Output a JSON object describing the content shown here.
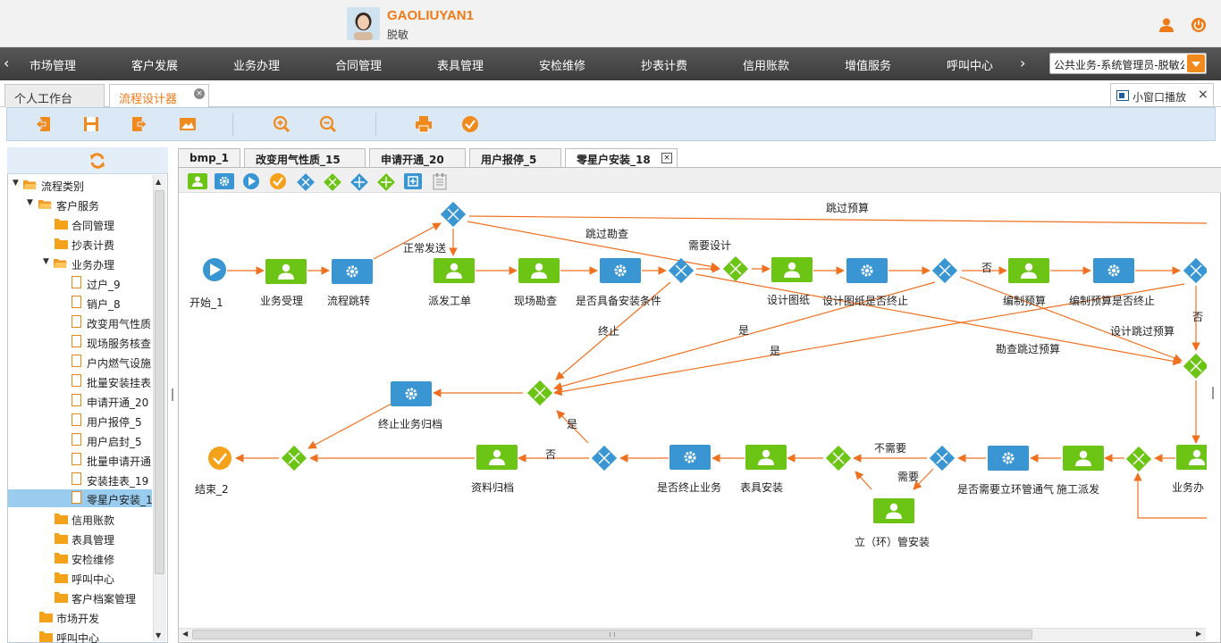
{
  "user": {
    "name": "GAOLIUYAN1",
    "role": "脱敏"
  },
  "nav": {
    "items": [
      "市场管理",
      "客户发展",
      "业务办理",
      "合同管理",
      "表具管理",
      "安检维修",
      "抄表计费",
      "信用账款",
      "增值服务",
      "呼叫中心"
    ]
  },
  "role_selector": {
    "value": "公共业务-系统管理员-脱敏公"
  },
  "tabs": [
    "个人工作台",
    "流程设计器"
  ],
  "mini_window": "小窗口播放",
  "tree": {
    "root": "流程类别",
    "customer_service": "客户服务",
    "contract": "合同管理",
    "metering": "抄表计费",
    "business": "业务办理",
    "leaves": [
      "过户_9",
      "销户_8",
      "改变用气性质",
      "现场服务核查",
      "户内燃气设施",
      "批量安装挂表",
      "申请开通_20",
      "用户报停_5",
      "用户启封_5",
      "批量申请开通",
      "安装挂表_19",
      "零星户安装_1"
    ],
    "after": [
      "信用账款",
      "表具管理",
      "安检维修",
      "呼叫中心",
      "客户档案管理"
    ],
    "market": "市场开发",
    "callcenter": "呼叫中心"
  },
  "process_tabs": [
    "bmp_1",
    "改变用气性质_15",
    "申请开通_20",
    "用户报停_5",
    "零星户安装_18"
  ],
  "diagram": {
    "nodes": {
      "start": "开始_1",
      "accept": "业务受理",
      "jump": "流程跳转",
      "dispatch": "派发工单",
      "survey": "现场勘查",
      "cond": "是否具备安装条件",
      "design": "设计图纸",
      "design_end": "设计图纸是否终止",
      "budget": "编制预算",
      "budget_end": "编制预算是否终止",
      "archive_end": "终止业务归档",
      "end": "结束_2",
      "docs": "资料归档",
      "is_end": "是否终止业务",
      "meter": "表具安装",
      "need_pipe": "是否需要立环管通气",
      "construct": "施工派发",
      "biz": "业务办",
      "pipe": "立（环）管安装"
    },
    "edges": {
      "skip_budget": "跳过预算",
      "skip_survey": "跳过勘查",
      "normal": "正常发送",
      "need_design": "需要设计",
      "no1": "否",
      "no2": "否",
      "terminate": "终止",
      "yes1": "是",
      "yes2": "是",
      "survey_skip": "勘查跳过预算",
      "design_skip": "设计跳过预算",
      "yes3": "是",
      "no3": "否",
      "no_need": "不需要",
      "need": "需要"
    }
  },
  "colors": {
    "accent": "#ef7a18",
    "task_green": "#6cc514",
    "task_blue": "#3a96d2",
    "edge": "#f07020"
  }
}
